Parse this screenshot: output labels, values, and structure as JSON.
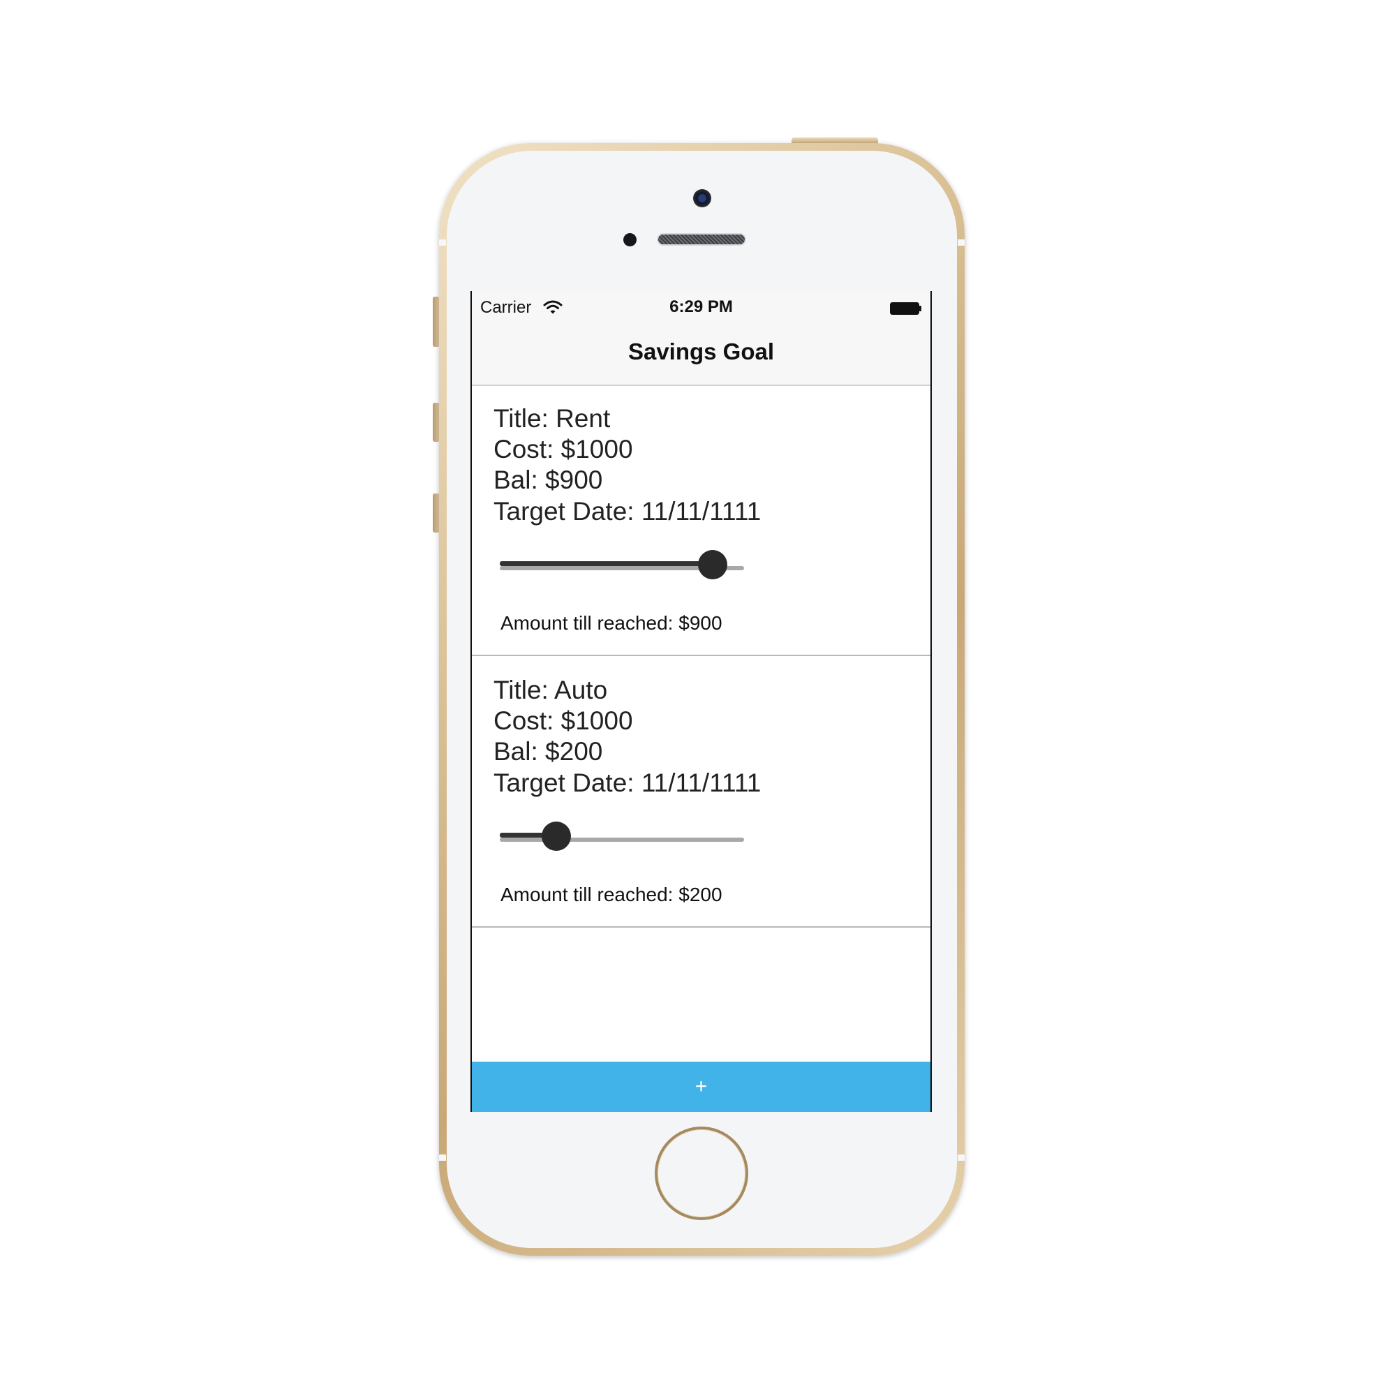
{
  "status_bar": {
    "carrier": "Carrier",
    "time": "6:29 PM"
  },
  "nav": {
    "title": "Savings Goal"
  },
  "goals": [
    {
      "title": "Title: Rent",
      "cost": "Cost: $1000",
      "balance": "Bal: $900",
      "target_date": "Target Date: 11/11/1111",
      "progress": 0.87,
      "amount_text": "Amount till reached: $900"
    },
    {
      "title": "Title: Auto",
      "cost": "Cost: $1000",
      "balance": "Bal: $200",
      "target_date": "Target Date: 11/11/1111",
      "progress": 0.23,
      "amount_text": "Amount till reached: $200"
    }
  ],
  "add_button": {
    "label": "+",
    "color": "#42b3e8"
  },
  "icons": [
    "wifi-icon",
    "battery-icon"
  ]
}
